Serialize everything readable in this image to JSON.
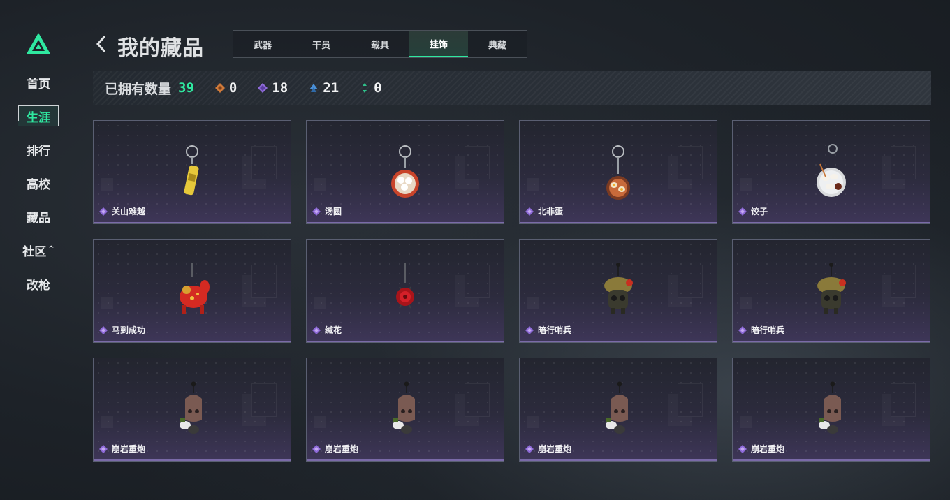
{
  "sidebar": {
    "items": [
      {
        "label": "首页"
      },
      {
        "label": "生涯"
      },
      {
        "label": "排行"
      },
      {
        "label": "高校"
      },
      {
        "label": "藏品"
      },
      {
        "label": "社区",
        "caret": "^"
      },
      {
        "label": "改枪"
      }
    ]
  },
  "header": {
    "title": "我的藏品",
    "tabs": [
      {
        "label": "武器"
      },
      {
        "label": "干员"
      },
      {
        "label": "载具"
      },
      {
        "label": "挂饰"
      },
      {
        "label": "典藏"
      }
    ],
    "active_tab": "挂饰"
  },
  "stats": {
    "label": "已拥有数量",
    "total": "39",
    "counts": [
      {
        "icon": "orange-diamond-icon",
        "color": "#d07a3a",
        "value": "0"
      },
      {
        "icon": "purple-diamond-icon",
        "color": "#8e6ad8",
        "value": "18"
      },
      {
        "icon": "blue-diamond-icon",
        "color": "#4a90d8",
        "value": "21"
      },
      {
        "icon": "green-diamond-icon",
        "color": "#2fc08a",
        "value": "0"
      }
    ]
  },
  "items": [
    {
      "name": "关山难越",
      "icon": "can-keychain-icon"
    },
    {
      "name": "汤圆",
      "icon": "tangyuan-bowl-icon"
    },
    {
      "name": "北非蛋",
      "icon": "shakshuka-pan-icon"
    },
    {
      "name": "饺子",
      "icon": "dumpling-plate-icon"
    },
    {
      "name": "马到成功",
      "icon": "red-horse-icon"
    },
    {
      "name": "缄花",
      "icon": "red-rose-icon"
    },
    {
      "name": "暗行哨兵",
      "icon": "camo-creature-icon"
    },
    {
      "name": "暗行哨兵",
      "icon": "camo-creature-icon"
    },
    {
      "name": "崩岩重炮",
      "icon": "rock-creature-icon"
    },
    {
      "name": "崩岩重炮",
      "icon": "rock-creature-icon"
    },
    {
      "name": "崩岩重炮",
      "icon": "rock-creature-icon"
    },
    {
      "name": "崩岩重炮",
      "icon": "rock-creature-icon"
    }
  ],
  "colors": {
    "accent": "#2fe8a0",
    "rarity_purple": "#8e6ad8"
  }
}
